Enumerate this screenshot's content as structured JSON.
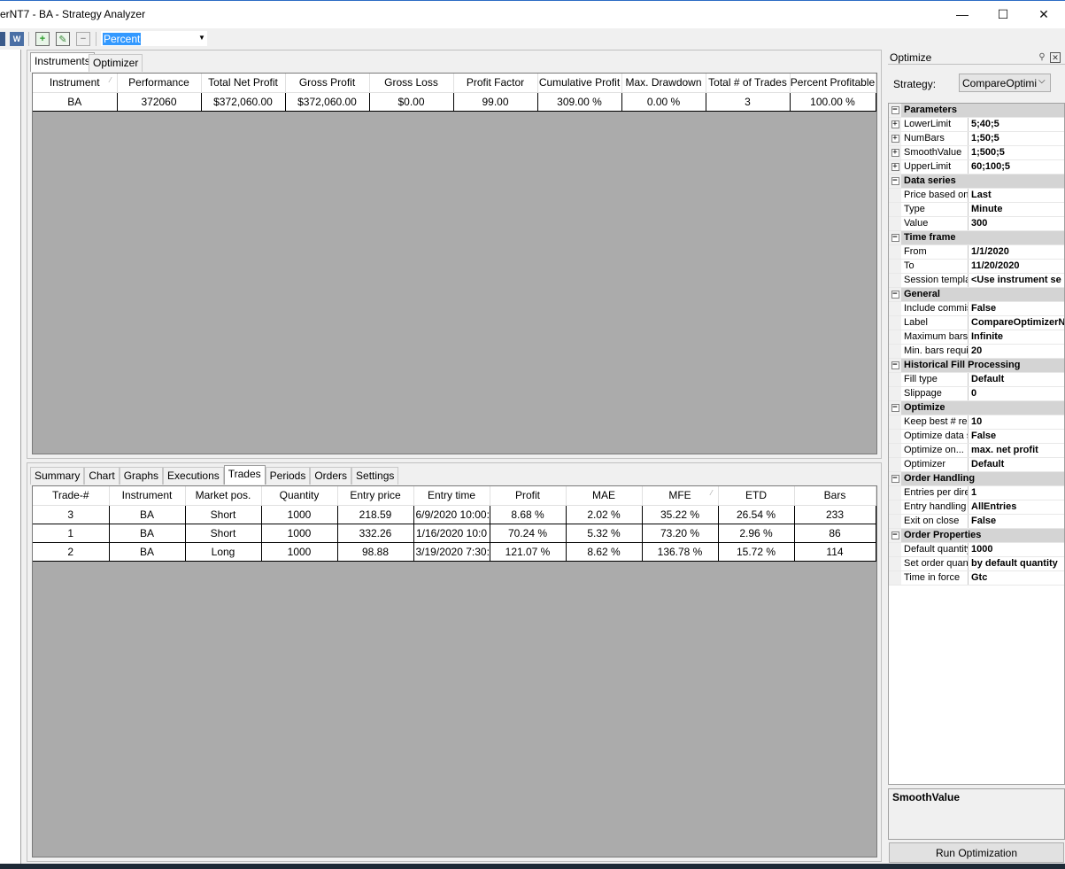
{
  "window": {
    "title": "erNT7 - BA - Strategy Analyzer",
    "minimize": "—",
    "maximize": "☐",
    "close": "✕"
  },
  "toolbar": {
    "display_mode": "Percent"
  },
  "top_tabs": [
    "Instruments",
    "Optimizer"
  ],
  "instruments_table": {
    "columns": [
      "Instrument",
      "Performance",
      "Total Net Profit",
      "Gross Profit",
      "Gross Loss",
      "Profit Factor",
      "Cumulative Profit",
      "Max. Drawdown",
      "Total # of Trades",
      "Percent Profitable"
    ],
    "rows": [
      [
        "BA",
        "372060",
        "$372,060.00",
        "$372,060.00",
        "$0.00",
        "99.00",
        "309.00 %",
        "0.00 %",
        "3",
        "100.00 %"
      ]
    ]
  },
  "bottom_tabs": [
    "Summary",
    "Chart",
    "Graphs",
    "Executions",
    "Trades",
    "Periods",
    "Orders",
    "Settings"
  ],
  "active_bottom_tab": "Trades",
  "trades_table": {
    "columns": [
      "Trade-#",
      "Instrument",
      "Market pos.",
      "Quantity",
      "Entry price",
      "Entry time",
      "Profit",
      "MAE",
      "MFE",
      "ETD",
      "Bars"
    ],
    "rows": [
      [
        "3",
        "BA",
        "Short",
        "1000",
        "218.59",
        "6/9/2020 10:00:",
        "8.68 %",
        "2.02 %",
        "35.22 %",
        "26.54 %",
        "233"
      ],
      [
        "1",
        "BA",
        "Short",
        "1000",
        "332.26",
        "1/16/2020 10:0",
        "70.24 %",
        "5.32 %",
        "73.20 %",
        "2.96 %",
        "86"
      ],
      [
        "2",
        "BA",
        "Long",
        "1000",
        "98.88",
        "3/19/2020 7:30:",
        "121.07 %",
        "8.62 %",
        "136.78 %",
        "15.72 %",
        "114"
      ]
    ]
  },
  "optimize_panel": {
    "title": "Optimize",
    "strategy_label": "Strategy:",
    "strategy_value": "CompareOptimize",
    "properties": [
      {
        "type": "cat",
        "name": "Parameters"
      },
      {
        "type": "prop",
        "name": "LowerLimit",
        "value": "5;40;5",
        "exp": true
      },
      {
        "type": "prop",
        "name": "NumBars",
        "value": "1;50;5",
        "exp": true
      },
      {
        "type": "prop",
        "name": "SmoothValue",
        "value": "1;500;5",
        "exp": true
      },
      {
        "type": "prop",
        "name": "UpperLimit",
        "value": "60;100;5",
        "exp": true
      },
      {
        "type": "cat",
        "name": "Data series"
      },
      {
        "type": "prop",
        "name": "Price based on",
        "value": "Last"
      },
      {
        "type": "prop",
        "name": "Type",
        "value": "Minute"
      },
      {
        "type": "prop",
        "name": "Value",
        "value": "300"
      },
      {
        "type": "cat",
        "name": "Time frame"
      },
      {
        "type": "prop",
        "name": "From",
        "value": "1/1/2020"
      },
      {
        "type": "prop",
        "name": "To",
        "value": "11/20/2020"
      },
      {
        "type": "prop",
        "name": "Session templa",
        "value": "<Use instrument se"
      },
      {
        "type": "cat",
        "name": "General"
      },
      {
        "type": "prop",
        "name": "Include commis",
        "value": "False"
      },
      {
        "type": "prop",
        "name": "Label",
        "value": "CompareOptimizerN"
      },
      {
        "type": "prop",
        "name": "Maximum bars",
        "value": "Infinite"
      },
      {
        "type": "prop",
        "name": "Min. bars requi",
        "value": "20"
      },
      {
        "type": "cat",
        "name": "Historical Fill Processing"
      },
      {
        "type": "prop",
        "name": "Fill type",
        "value": "Default"
      },
      {
        "type": "prop",
        "name": "Slippage",
        "value": "0"
      },
      {
        "type": "cat",
        "name": "Optimize"
      },
      {
        "type": "prop",
        "name": "Keep best # re",
        "value": "10"
      },
      {
        "type": "prop",
        "name": "Optimize data s",
        "value": "False"
      },
      {
        "type": "prop",
        "name": "Optimize on...",
        "value": "max. net profit"
      },
      {
        "type": "prop",
        "name": "Optimizer",
        "value": "Default"
      },
      {
        "type": "cat",
        "name": "Order Handling"
      },
      {
        "type": "prop",
        "name": "Entries per dire",
        "value": "1"
      },
      {
        "type": "prop",
        "name": "Entry handling",
        "value": "AllEntries"
      },
      {
        "type": "prop",
        "name": "Exit on close",
        "value": "False"
      },
      {
        "type": "cat",
        "name": "Order Properties"
      },
      {
        "type": "prop",
        "name": "Default quantity",
        "value": "1000"
      },
      {
        "type": "prop",
        "name": "Set order quan",
        "value": "by default quantity"
      },
      {
        "type": "prop",
        "name": "Time in force",
        "value": "Gtc"
      }
    ],
    "description_title": "SmoothValue",
    "run_button": "Run Optimization"
  }
}
